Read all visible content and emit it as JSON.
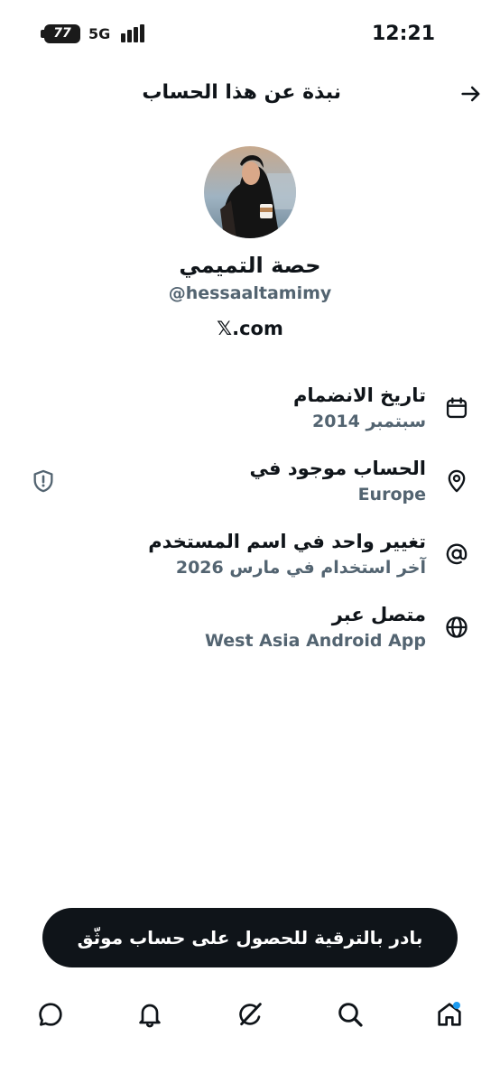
{
  "status_bar": {
    "battery": "77",
    "network": "5G",
    "time": "12:21"
  },
  "header": {
    "title": "نبذة عن هذا الحساب",
    "back_icon": "arrow-right-icon"
  },
  "profile": {
    "display_name": "حصة التميمي",
    "handle": "@hessaaltamimy",
    "website": "𝕏.com"
  },
  "info": [
    {
      "icon": "calendar-icon",
      "title": "تاريخ الانضمام",
      "value": "سبتمبر 2014"
    },
    {
      "icon": "location-pin-icon",
      "title": "الحساب موجود في",
      "value": "Europe"
    },
    {
      "icon": "at-sign-icon",
      "title": "تغيير واحد في اسم المستخدم",
      "value": "آخر استخدام في مارس 2026"
    },
    {
      "icon": "globe-icon",
      "title": "متصل عبر",
      "value": "West Asia Android App"
    }
  ],
  "upgrade_button": {
    "label": "بادر بالترقية للحصول على حساب موثّق"
  },
  "bottom_nav": [
    "chat-icon",
    "bell-icon",
    "grok-icon",
    "search-icon",
    "home-icon"
  ],
  "colors": {
    "primary_text": "#0f1419",
    "secondary_text": "#536471",
    "accent": "#1d9bf0"
  }
}
